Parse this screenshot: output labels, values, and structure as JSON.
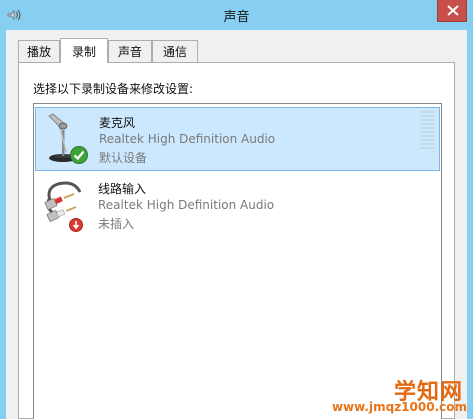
{
  "window": {
    "title": "声音",
    "app_icon": "speaker-icon",
    "close_icon": "close-icon",
    "close_color": "#c7504b"
  },
  "tabs": [
    {
      "label": "播放",
      "active": false
    },
    {
      "label": "录制",
      "active": true
    },
    {
      "label": "声音",
      "active": false
    },
    {
      "label": "通信",
      "active": false
    }
  ],
  "panel": {
    "instruction": "选择以下录制设备来修改设置:"
  },
  "devices": [
    {
      "name": "麦克风",
      "driver": "Realtek High Definition Audio",
      "status": "默认设备",
      "icon": "microphone-icon",
      "badge": "default-check-icon",
      "selected": true,
      "level_segments": 10
    },
    {
      "name": "线路输入",
      "driver": "Realtek High Definition Audio",
      "status": "未插入",
      "icon": "line-in-cable-icon",
      "badge": "unplugged-arrow-icon",
      "selected": false
    }
  ],
  "watermark": {
    "title": "学知网",
    "url": "www.jmqz1000.com"
  }
}
